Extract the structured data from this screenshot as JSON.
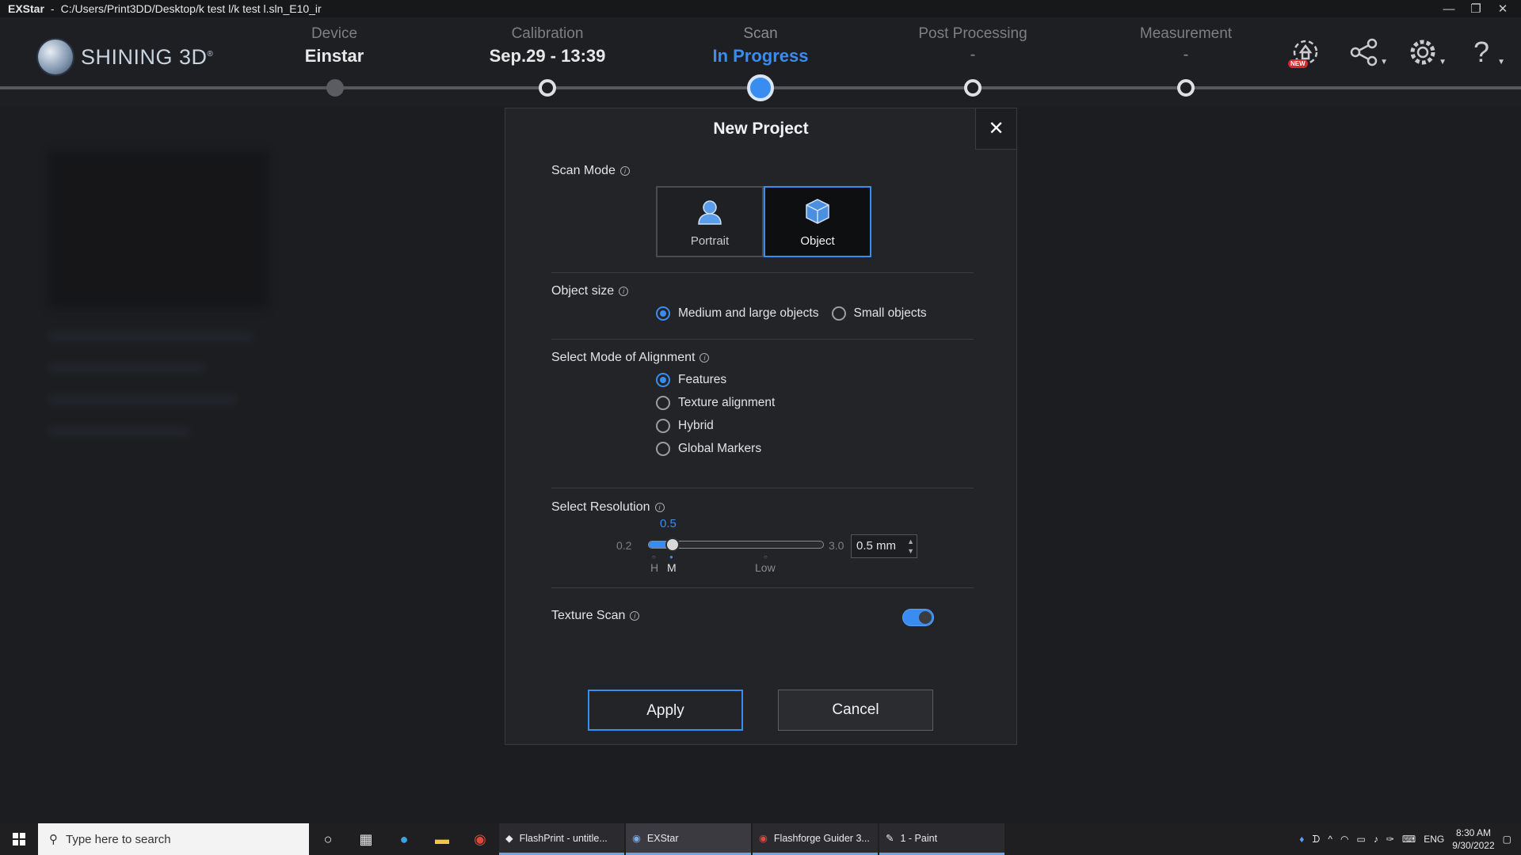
{
  "titlebar": {
    "app": "EXStar",
    "separator": "-",
    "path": "C:/Users/Print3DD/Desktop/k test l/k test l.sln_E10_ir",
    "minimize": "—",
    "restore": "❐",
    "close": "✕"
  },
  "brand": {
    "name": "SHINING 3D",
    "reg": "®"
  },
  "steps": [
    {
      "label": "Device",
      "value": "Einstar"
    },
    {
      "label": "Calibration",
      "value": "Sep.29 - 13:39"
    },
    {
      "label": "Scan",
      "value": "In Progress"
    },
    {
      "label": "Post Processing",
      "value": "-"
    },
    {
      "label": "Measurement",
      "value": "-"
    }
  ],
  "header_icons": {
    "new_badge": "NEW"
  },
  "dialog": {
    "title": "New Project",
    "close": "✕",
    "scan_mode": {
      "label": "Scan Mode",
      "options": [
        "Portrait",
        "Object"
      ],
      "selected": "Object"
    },
    "object_size": {
      "label": "Object size",
      "options": [
        "Medium and large objects",
        "Small objects"
      ],
      "selected": "Medium and large objects"
    },
    "alignment": {
      "label": "Select Mode of Alignment",
      "options": [
        "Features",
        "Texture alignment",
        "Hybrid",
        "Global Markers"
      ],
      "selected": "Features"
    },
    "resolution": {
      "label": "Select Resolution",
      "min": "0.2",
      "max": "3.0",
      "current": "0.5",
      "input_value": "0.5 mm",
      "marks": [
        "H",
        "M",
        "Low"
      ],
      "fraction": 0.107
    },
    "texture_scan": {
      "label": "Texture Scan",
      "enabled": true
    },
    "apply": "Apply",
    "cancel": "Cancel"
  },
  "taskbar": {
    "search_placeholder": "Type here to search",
    "apps": [
      "FlashPrint - untitle...",
      "EXStar",
      "Flashforge Guider 3...",
      "1 - Paint"
    ],
    "lang": "ENG",
    "time": "8:30 AM",
    "date": "9/30/2022"
  }
}
